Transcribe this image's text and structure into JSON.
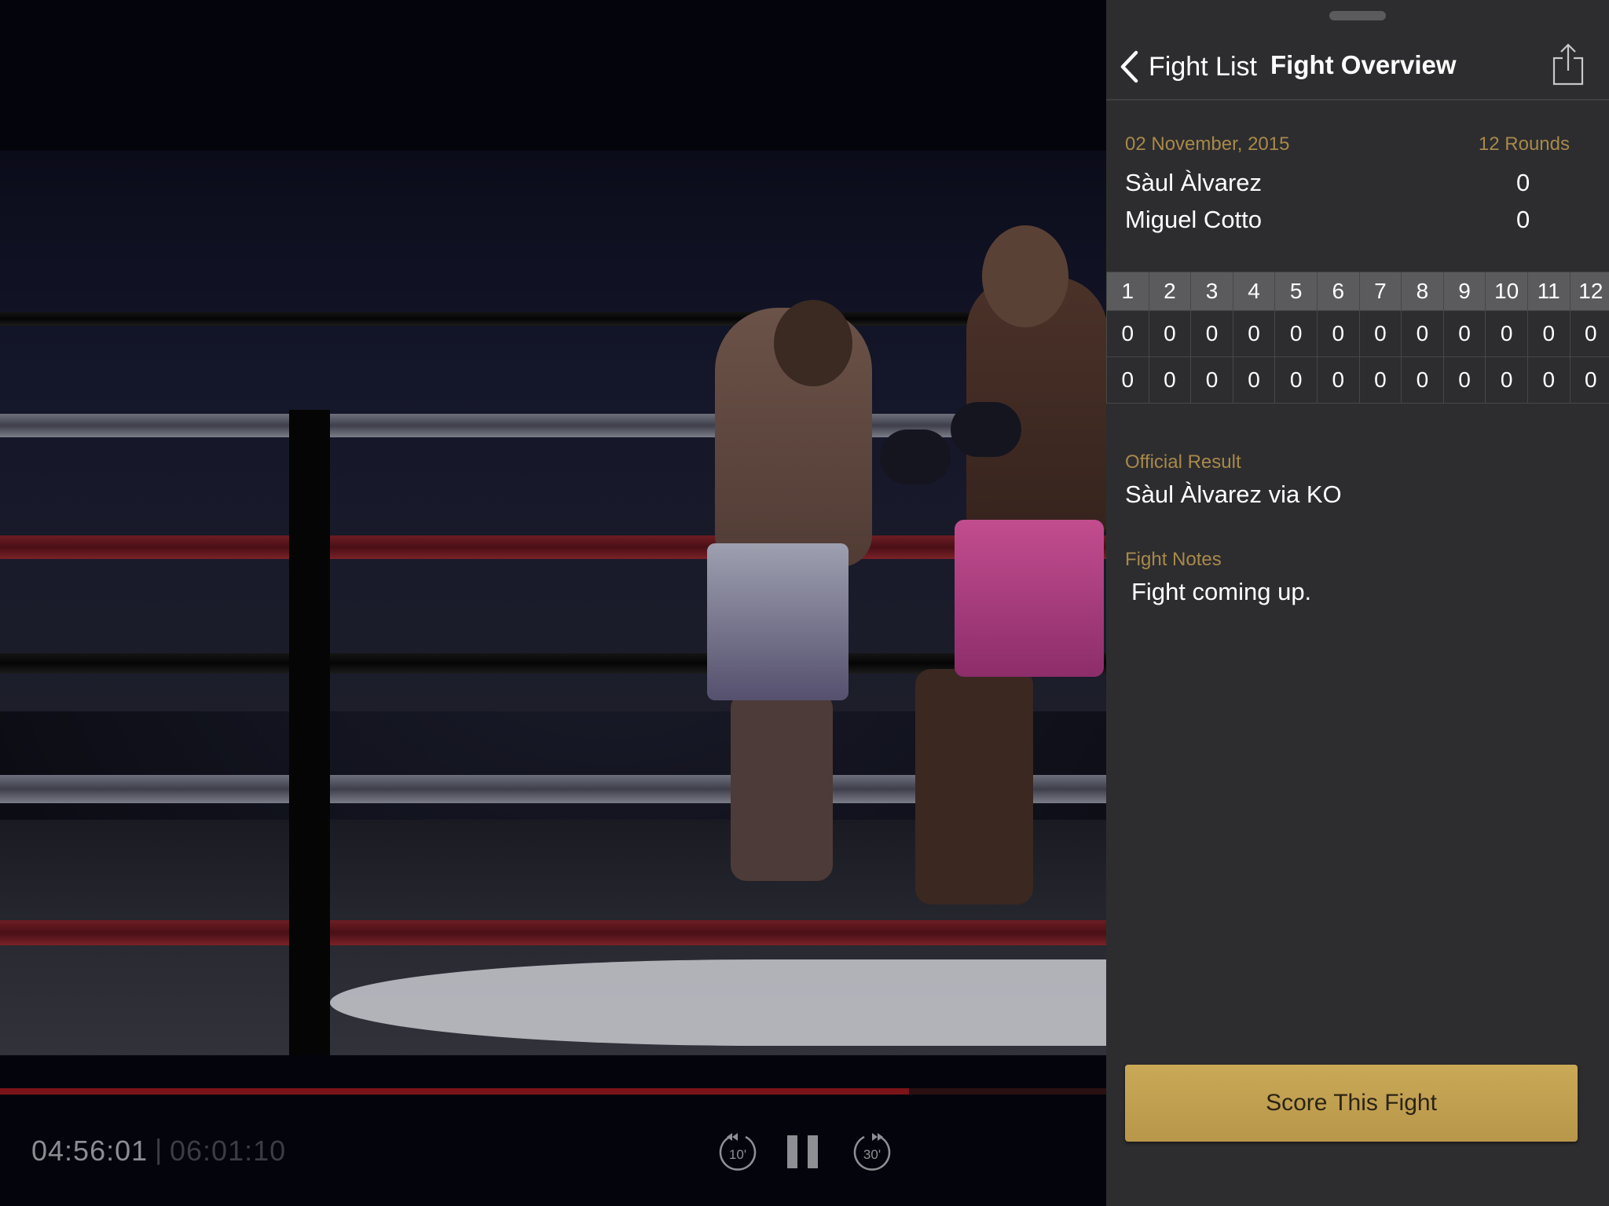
{
  "player": {
    "time_current": "04:56:01",
    "time_separator": "|",
    "time_total": "06:01:10",
    "progress": 0.822,
    "skip_back_label": "10'",
    "skip_forward_label": "30'",
    "accent_color": "#7b1419"
  },
  "panel": {
    "back_label": "Fight List",
    "title": "Fight Overview",
    "date": "02 November, 2015",
    "rounds_label": "12 Rounds",
    "fighters": [
      {
        "name": "Sàul Àlvarez",
        "total": "0"
      },
      {
        "name": "Miguel Cotto",
        "total": "0"
      }
    ],
    "round_numbers": [
      "1",
      "2",
      "3",
      "4",
      "5",
      "6",
      "7",
      "8",
      "9",
      "10",
      "11",
      "12"
    ],
    "round_scores": [
      [
        "0",
        "0",
        "0",
        "0",
        "0",
        "0",
        "0",
        "0",
        "0",
        "0",
        "0",
        "0"
      ],
      [
        "0",
        "0",
        "0",
        "0",
        "0",
        "0",
        "0",
        "0",
        "0",
        "0",
        "0",
        "0"
      ]
    ],
    "result_label": "Official Result",
    "result_value": "Sàul Àlvarez via KO",
    "notes_label": "Fight Notes",
    "notes_value": "Fight coming up.",
    "score_button_label": "Score This Fight",
    "gold_color": "#a8894a"
  }
}
